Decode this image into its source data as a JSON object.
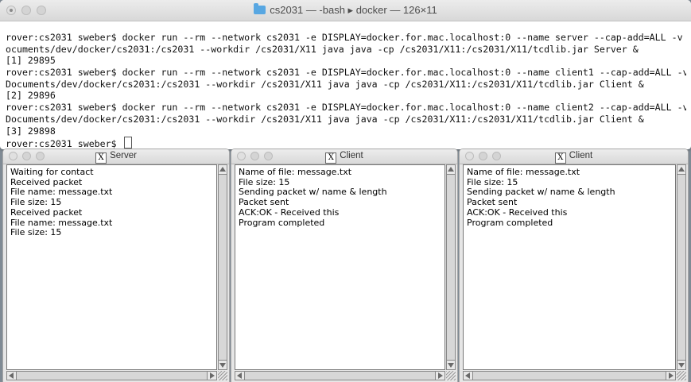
{
  "terminal": {
    "title": "cs2031 — -bash ▸ docker — 126×11",
    "lines": [
      "rover:cs2031 sweber$ docker run --rm --network cs2031 -e DISPLAY=docker.for.mac.localhost:0 --name server --cap-add=ALL -v ~/D",
      "ocuments/dev/docker/cs2031:/cs2031 --workdir /cs2031/X11 java java -cp /cs2031/X11:/cs2031/X11/tcdlib.jar Server &",
      "[1] 29895",
      "rover:cs2031 sweber$ docker run --rm --network cs2031 -e DISPLAY=docker.for.mac.localhost:0 --name client1 --cap-add=ALL -v ~/",
      "Documents/dev/docker/cs2031:/cs2031 --workdir /cs2031/X11 java java -cp /cs2031/X11:/cs2031/X11/tcdlib.jar Client &",
      "[2] 29896",
      "rover:cs2031 sweber$ docker run --rm --network cs2031 -e DISPLAY=docker.for.mac.localhost:0 --name client2 --cap-add=ALL -v ~/",
      "Documents/dev/docker/cs2031:/cs2031 --workdir /cs2031/X11 java java -cp /cs2031/X11:/cs2031/X11/tcdlib.jar Client &",
      "[3] 29898",
      "rover:cs2031 sweber$ "
    ]
  },
  "windows": [
    {
      "title": "Server",
      "lines": [
        "Waiting for contact",
        "Received packet",
        "File name: message.txt",
        "File size: 15",
        "Received packet",
        "File name: message.txt",
        "File size: 15"
      ]
    },
    {
      "title": "Client",
      "lines": [
        "Name of file: message.txt",
        "File size: 15",
        "Sending packet w/ name & length",
        "Packet sent",
        "ACK:OK - Received this",
        "Program completed"
      ]
    },
    {
      "title": "Client",
      "lines": [
        "Name of file: message.txt",
        "File size: 15",
        "Sending packet w/ name & length",
        "Packet sent",
        "ACK:OK - Received this",
        "Program completed"
      ]
    }
  ]
}
